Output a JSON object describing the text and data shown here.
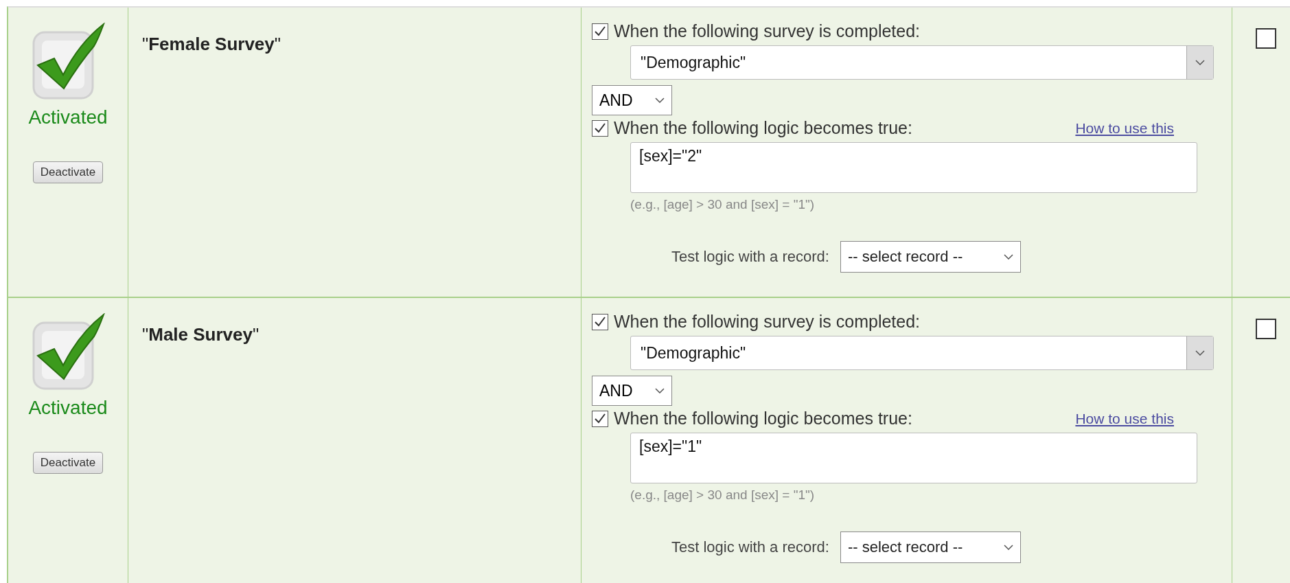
{
  "rows": [
    {
      "status": "Activated",
      "active": true,
      "button": "Deactivate",
      "name": "\"**Female Survey**\"",
      "survey_checked": true,
      "survey_label": "When the following survey is completed:",
      "survey_value": "\"Demographic\"",
      "operator": "AND",
      "logic_checked": true,
      "logic_label": "When the following logic becomes true:",
      "help_link": "How to use this",
      "logic_value": "[sex]=\"2\"",
      "hint": "(e.g., [age] > 30 and [sex] = \"1\")",
      "test_label": "Test logic with a record:",
      "test_value": "-- select record --",
      "checked": false
    },
    {
      "status": "Activated",
      "active": true,
      "button": "Deactivate",
      "name": "\"**Male Survey**\"",
      "survey_checked": true,
      "survey_label": "When the following survey is completed:",
      "survey_value": "\"Demographic\"",
      "operator": "AND",
      "logic_checked": true,
      "logic_label": "When the following logic becomes true:",
      "help_link": "How to use this",
      "logic_value": "[sex]=\"1\"",
      "hint": "(e.g., [age] > 30 and [sex] = \"1\")",
      "test_label": "Test logic with a record:",
      "test_value": "-- select record --",
      "checked": false
    }
  ]
}
